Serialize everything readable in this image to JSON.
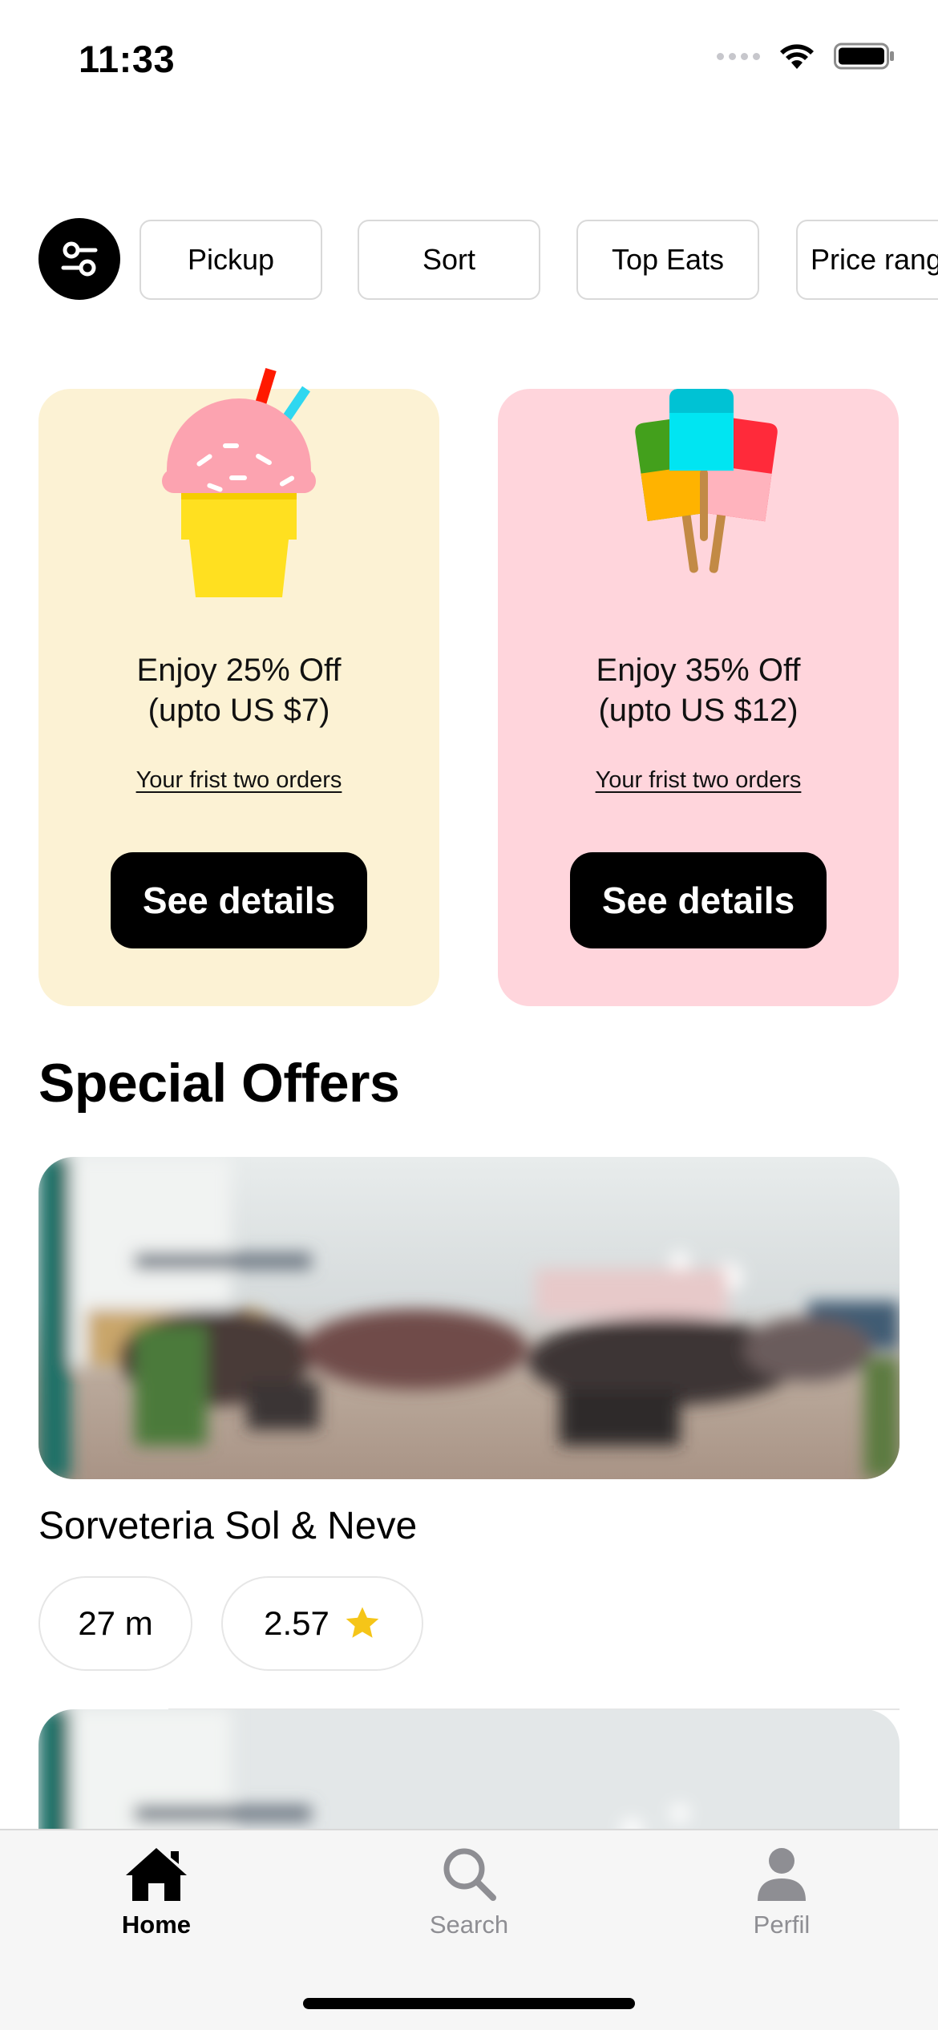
{
  "status_bar": {
    "time": "11:33"
  },
  "filters": {
    "toggle_icon": "sliders-icon",
    "chips": [
      "Pickup",
      "Sort",
      "Top Eats",
      "Price range"
    ]
  },
  "promos": [
    {
      "title_line1": "Enjoy 25% Off",
      "title_line2": "(upto US $7)",
      "subtitle": "Your frist two orders",
      "button": "See details",
      "bg": "#fcf2d4",
      "art": "ice-cream-cone-icon"
    },
    {
      "title_line1": "Enjoy 35% Off",
      "title_line2": "(upto US $12)",
      "subtitle": "Your frist two orders",
      "button": "See details",
      "bg": "#ffd5dc",
      "art": "popsicles-icon"
    }
  ],
  "special_offers": {
    "title": "Special Offers",
    "items": [
      {
        "name": "Sorveteria Sol & Neve",
        "distance": "27 m",
        "rating": "2.57",
        "rating_icon": "star-icon"
      }
    ]
  },
  "tab_bar": {
    "tabs": [
      {
        "label": "Home",
        "icon": "home-icon",
        "active": true
      },
      {
        "label": "Search",
        "icon": "search-icon",
        "active": false
      },
      {
        "label": "Perfil",
        "icon": "person-icon",
        "active": false
      }
    ]
  },
  "colors": {
    "accent": "#000000",
    "star": "#f5c518",
    "inactive": "#8e8e93"
  }
}
